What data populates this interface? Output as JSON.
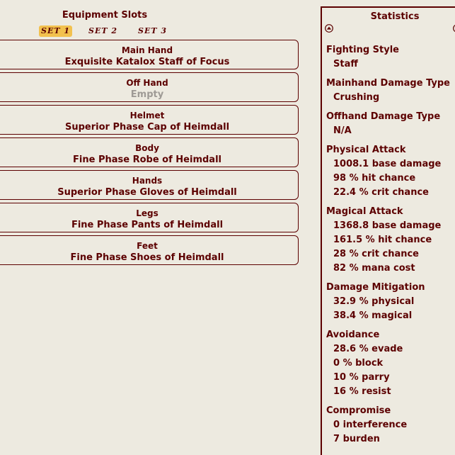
{
  "equipment": {
    "title": "Equipment Slots",
    "sets": [
      "SET 1",
      "SET 2",
      "SET 3"
    ],
    "active_set": 0,
    "slots": [
      {
        "name": "Main Hand",
        "item": "Exquisite Katalox Staff of Focus"
      },
      {
        "name": "Off Hand",
        "item": "Empty"
      },
      {
        "name": "Helmet",
        "item": "Superior Phase Cap of Heimdall"
      },
      {
        "name": "Body",
        "item": "Fine Phase Robe of Heimdall"
      },
      {
        "name": "Hands",
        "item": "Superior Phase Gloves of Heimdall"
      },
      {
        "name": "Legs",
        "item": "Fine Phase Pants of Heimdall"
      },
      {
        "name": "Feet",
        "item": "Fine Phase Shoes of Heimdall"
      }
    ]
  },
  "stats": {
    "title": "Statistics",
    "groups": [
      {
        "title": "Fighting Style",
        "values": [
          "Staff"
        ]
      },
      {
        "title": "Mainhand Damage Type",
        "values": [
          "Crushing"
        ]
      },
      {
        "title": "Offhand Damage Type",
        "values": [
          "N/A"
        ]
      },
      {
        "title": "Physical Attack",
        "values": [
          "1008.1 base damage",
          "98 % hit chance",
          "22.4 % crit chance"
        ]
      },
      {
        "title": "Magical Attack",
        "values": [
          "1368.8 base damage",
          "161.5 % hit chance",
          "28 % crit chance",
          "82 % mana cost"
        ]
      },
      {
        "title": "Damage Mitigation",
        "values": [
          "32.9 % physical",
          "38.4 % magical"
        ]
      },
      {
        "title": "Avoidance",
        "values": [
          "28.6 % evade",
          "0 % block",
          "10 % parry",
          "16 % resist"
        ]
      },
      {
        "title": "Compromise",
        "values": [
          "0 interference",
          "7 burden"
        ]
      }
    ]
  },
  "colors": {
    "text": "#5C0000",
    "background": "#EDEAE0",
    "active_tab": "#F2C14E",
    "empty": "#9E9A95"
  },
  "icons": [
    "circle-up-icon",
    "circle-down-icon"
  ]
}
